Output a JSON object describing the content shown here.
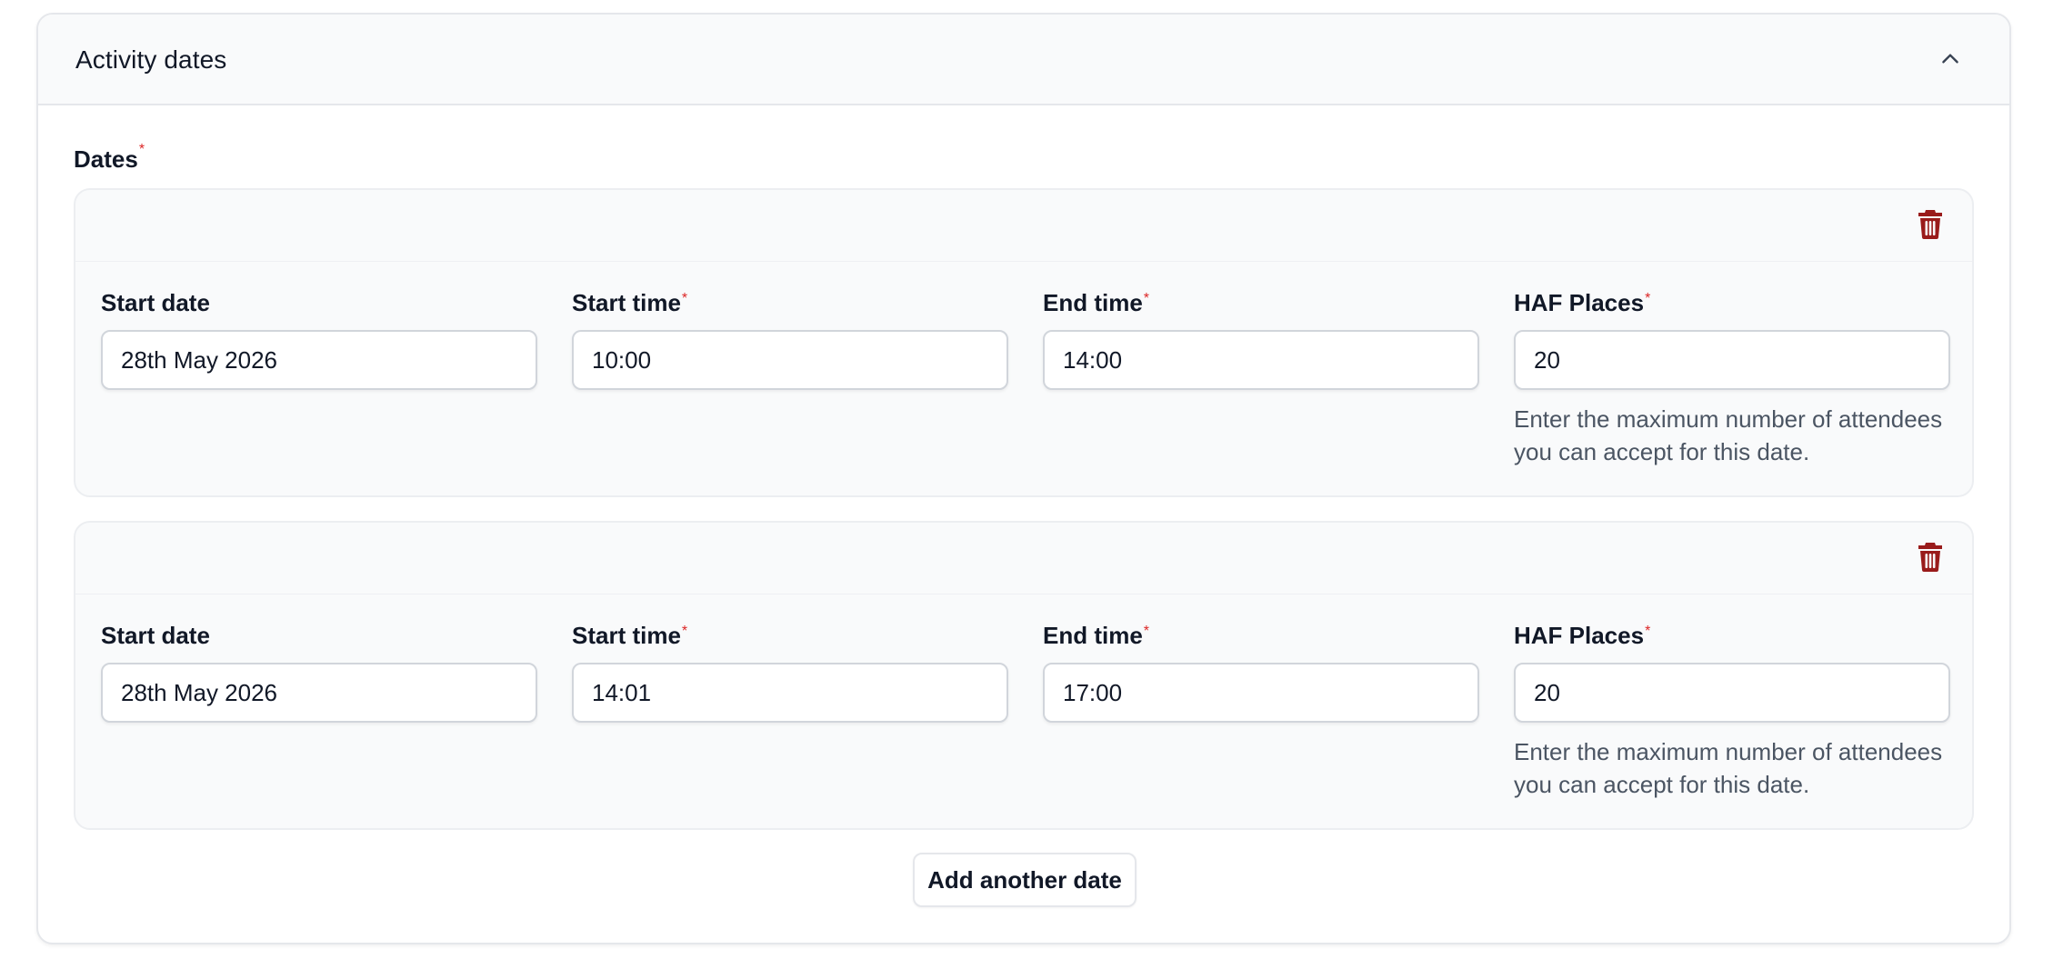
{
  "section": {
    "title": "Activity dates"
  },
  "dates": {
    "label": "Dates",
    "required_mark": "*"
  },
  "entries": [
    {
      "start_date_label": "Start date",
      "start_date_value": "28th May 2026",
      "start_time_label": "Start time",
      "start_time_value": "10:00",
      "end_time_label": "End time",
      "end_time_value": "14:00",
      "places_label": "HAF Places",
      "places_value": "20",
      "places_hint": "Enter the maximum number of attendees you can accept for this date."
    },
    {
      "start_date_label": "Start date",
      "start_date_value": "28th May 2026",
      "start_time_label": "Start time",
      "start_time_value": "14:01",
      "end_time_label": "End time",
      "end_time_value": "17:00",
      "places_label": "HAF Places",
      "places_value": "20",
      "places_hint": "Enter the maximum number of attendees you can accept for this date."
    }
  ],
  "actions": {
    "add_label": "Add another date"
  },
  "icons": {
    "collapse": "chevron-up-icon",
    "delete": "trash-icon"
  },
  "colors": {
    "required": "#dc2626",
    "delete_icon": "#991b1b"
  }
}
